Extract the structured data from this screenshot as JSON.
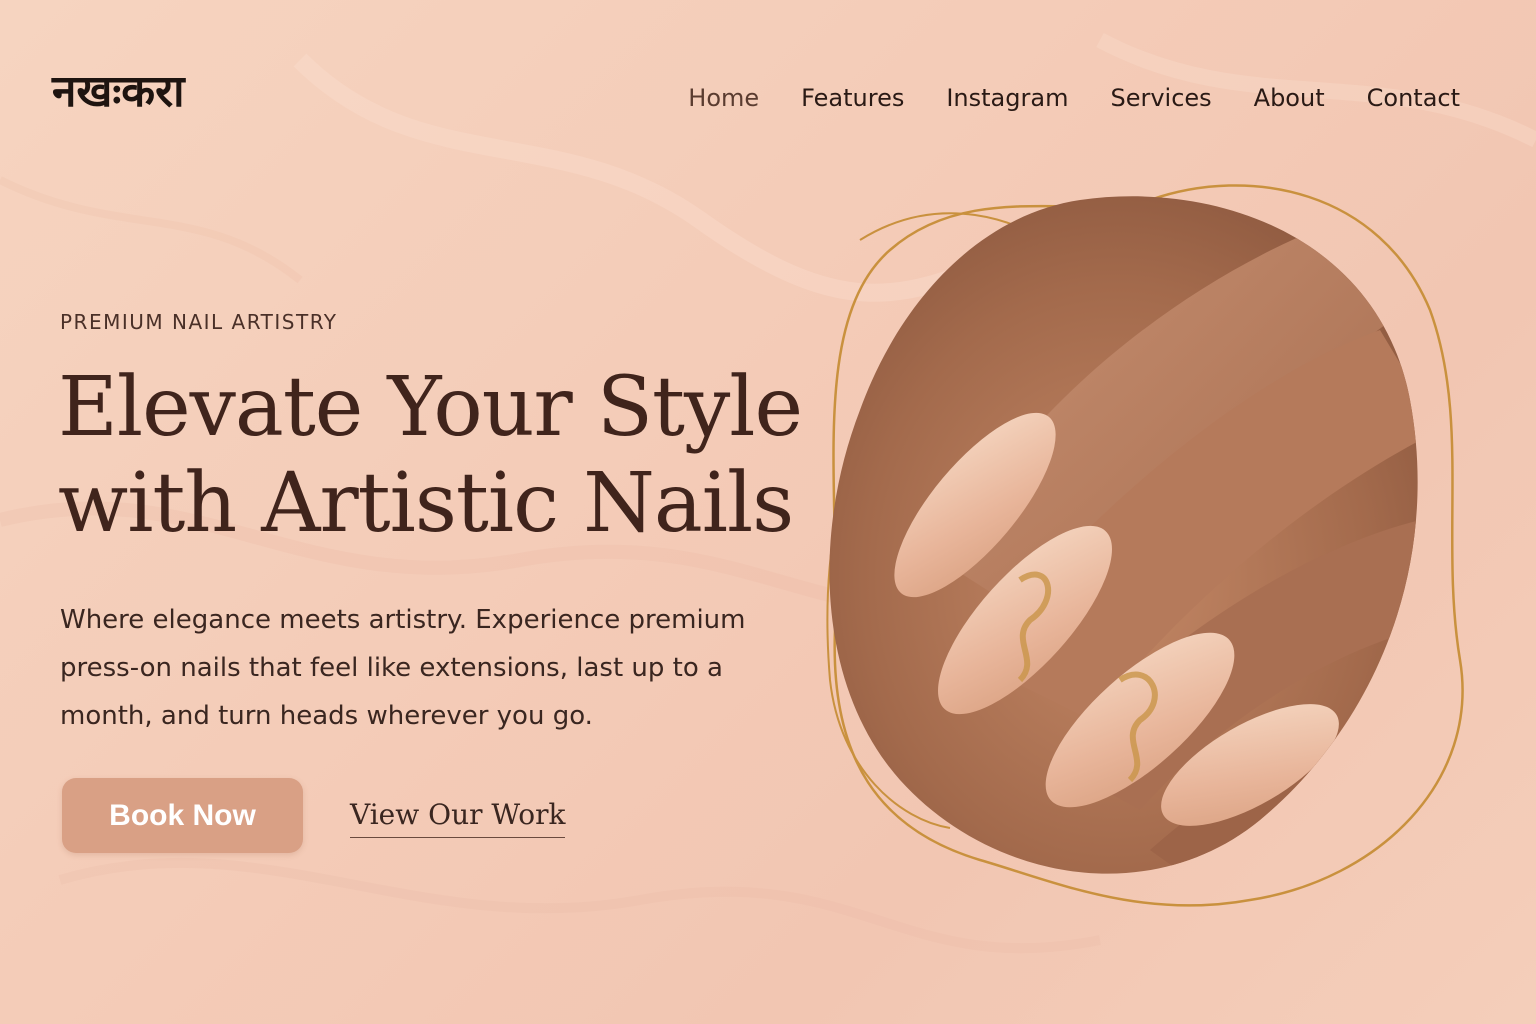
{
  "header": {
    "logo": "नखःकरा",
    "nav": [
      {
        "label": "Home",
        "active": true
      },
      {
        "label": "Features",
        "active": false
      },
      {
        "label": "Instagram",
        "active": false
      },
      {
        "label": "Services",
        "active": false
      },
      {
        "label": "About",
        "active": false
      },
      {
        "label": "Contact",
        "active": false
      }
    ]
  },
  "hero": {
    "eyebrow": "PREMIUM NAIL ARTISTRY",
    "headline_line1": "Elevate Your Style",
    "headline_line2": "with Artistic Nails",
    "subtext": "Where elegance meets artistry. Experience premium press-on nails that feel like extensions, last up to a month, and turn heads wherever you go.",
    "primary_cta": "Book Now",
    "secondary_cta": "View Our Work",
    "image": "hand-with-almond-nails-gold-foil"
  },
  "colors": {
    "background": "#f4ccb8",
    "accent": "#d9a085",
    "heading": "#40241c",
    "gold_outline": "#c9913e"
  }
}
